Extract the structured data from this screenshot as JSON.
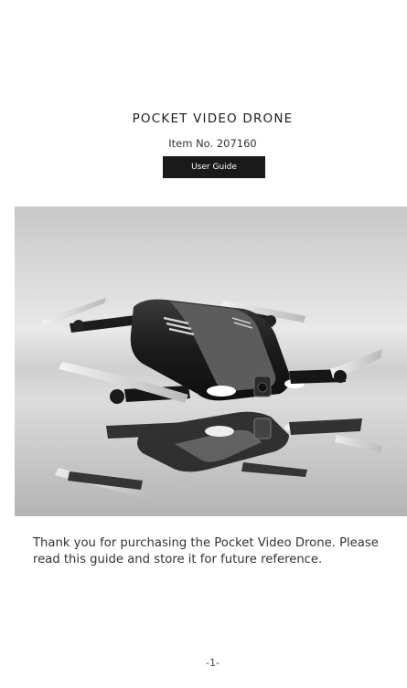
{
  "document": {
    "title": "POCKET VIDEO DRONE",
    "item_number": "Item No. 207160",
    "badge_label": "User Guide",
    "intro_text": "Thank you for purchasing the Pocket Video Drone. Please read this guide and store it for future reference.",
    "page_number": "-1-"
  },
  "colors": {
    "badge_background": "#1a1a1a",
    "badge_text": "#ffffff",
    "body_text": "#333333"
  },
  "photo": {
    "subject": "drone-with-reflection"
  }
}
